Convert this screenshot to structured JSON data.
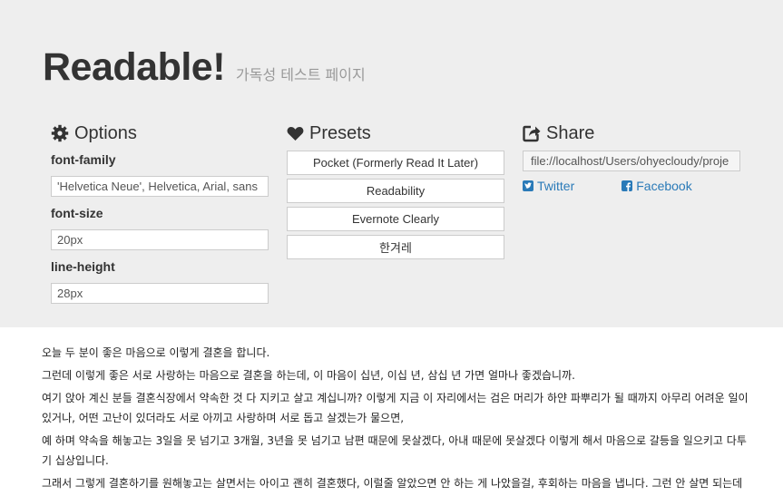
{
  "header": {
    "title": "Readable!",
    "subtitle": "가독성 테스트 페이지"
  },
  "options": {
    "heading": "Options",
    "icon": "gear-icon",
    "font_family": {
      "label": "font-family",
      "value": "'Helvetica Neue', Helvetica, Arial, sans"
    },
    "font_size": {
      "label": "font-size",
      "value": "20px"
    },
    "line_height": {
      "label": "line-height",
      "value": "28px"
    }
  },
  "presets": {
    "heading": "Presets",
    "icon": "heart-icon",
    "items": [
      "Pocket (Formerly Read It Later)",
      "Readability",
      "Evernote Clearly",
      "한겨레"
    ]
  },
  "share": {
    "heading": "Share",
    "icon": "share-icon",
    "url": "file://localhost/Users/ohyecloudy/proje",
    "twitter": "Twitter",
    "facebook": "Facebook",
    "link_color": "#2a7ab8"
  },
  "content": {
    "paragraphs": [
      "오늘 두 분이 좋은 마음으로 이렇게 결혼을 합니다.",
      "그런데 이렇게 좋은 서로 사랑하는 마음으로 결혼을 하는데, 이 마음이 십년, 이십 년, 삼십 년 가면 얼마나 좋겠습니까.",
      "여기 앉아 계신 분들 결혼식장에서 약속한 것 다 지키고 살고 계십니까? 이렇게 지금 이 자리에서는 검은 머리가 하얀 파뿌리가 될 때까지 아무리 어려운 일이 있거나, 어떤 고난이 있더라도 서로 아끼고 사랑하며 서로 돕고 살겠는가 물으면,",
      "예 하며 약속을 해놓고는 3일을 못 넘기고 3개월, 3년을 못 넘기고 남편 때문에 못살겠다, 아내 때문에 못살겠다 이렇게 해서 마음으로 갈등을 일으키고 다투기 십상입니다.",
      "그래서 그렇게 결혼하기를 원해놓고는 살면서는 아이고 괜히 결혼했다, 이럴줄 알았으면 안 하는 게 나았을걸, 후회하는 마음을 냅니다. 그런 안 살면 되는데"
    ]
  },
  "colors": {
    "header_bg": "#eeeeee",
    "subtitle": "#999999"
  }
}
